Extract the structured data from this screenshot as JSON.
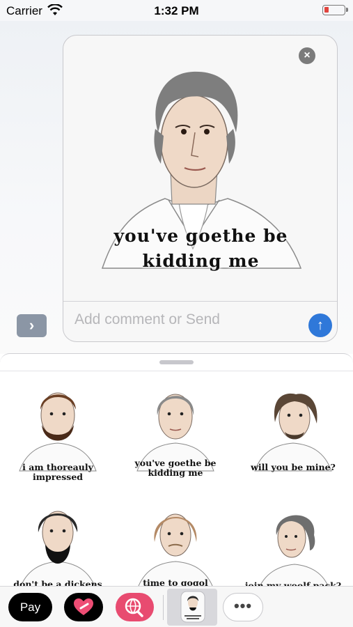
{
  "status_bar": {
    "carrier": "Carrier",
    "time": "1:32 PM",
    "battery_color": "#e0443e"
  },
  "compose": {
    "close_icon": "close-icon",
    "sticker_caption_line1": "you've goethe be",
    "sticker_caption_line2": "kidding me",
    "comment_placeholder": "Add comment or Send",
    "comment_value": "",
    "send_icon": "arrow-up-icon",
    "expand_icon": "chevron-right-icon",
    "accent_color": "#2f78d9"
  },
  "drawer": {
    "stickers": [
      {
        "label_line1": "i am thoreauly",
        "label_line2": "impressed",
        "hair": "#6b3f24",
        "beard": "#4a2a18"
      },
      {
        "label_line1": "you've goethe be",
        "label_line2": "kidding me",
        "hair": "#8a8a8a",
        "beard": ""
      },
      {
        "label_line1": "will you be mine?",
        "label_line2": "",
        "hair": "#5a4636",
        "beard": "#4a3a2c"
      },
      {
        "label_line1": "don't be a dickens",
        "label_line2": "",
        "hair": "#2a2a2a",
        "beard": "#111111"
      },
      {
        "label_line1": "time to gogol",
        "label_line2": "",
        "hair": "#b48a66",
        "beard": ""
      },
      {
        "label_line1": "join my woolf pack?",
        "label_line2": "",
        "hair": "#6e6e6e",
        "beard": ""
      }
    ]
  },
  "app_strip": {
    "apple_pay_label": "Pay",
    "apple_pay_icon": "apple-icon",
    "heart_app_icon": "heart-icon",
    "search_app_icon": "globe-search-icon",
    "current_app_icon": "literary-stickers-icon",
    "more_label": "•••"
  }
}
